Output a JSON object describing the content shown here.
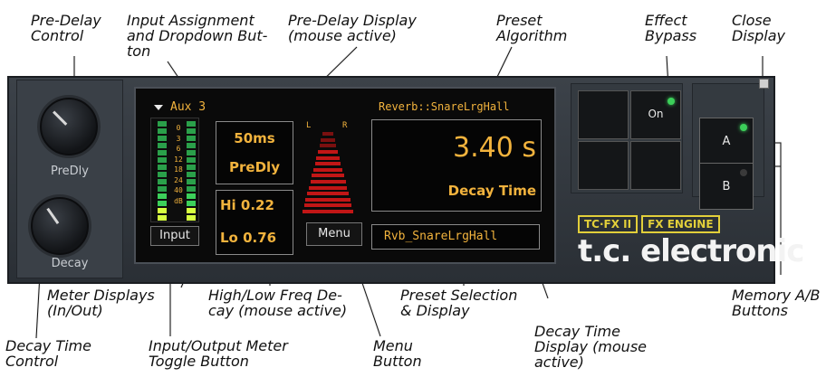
{
  "callouts": {
    "predelay_control": "Pre-Delay\nControl",
    "input_assignment": "Input Assignment\nand Dropdown But-\nton",
    "predelay_display": "Pre-Delay Display\n(mouse active)",
    "preset_algorithm": "Preset\nAlgorithm",
    "effect_bypass": "Effect\nBypass",
    "close_display": "Close\nDisplay",
    "meter_displays": "Meter Displays\n(In/Out)",
    "hilo_freq": "High/Low Freq De-\ncay (mouse active)",
    "preset_selection": "Preset Selection\n& Display",
    "memory_ab": "Memory A/B\nButtons",
    "decay_time_control": "Decay Time\nControl",
    "io_meter_toggle": "Input/Output Meter\nToggle Button",
    "menu_button": "Menu\nButton",
    "decay_time_display": "Decay Time\nDisplay (mouse\nactive)"
  },
  "plugin": {
    "knobs": {
      "predelay_label": "PreDly",
      "decay_label": "Decay"
    },
    "input_assignment": "Aux 3",
    "meter_scale": [
      "0",
      "3",
      "6",
      "12",
      "18",
      "24",
      "40",
      "dB"
    ],
    "input_toggle_label": "Input",
    "predelay": {
      "value": "50ms",
      "label": "PreDly"
    },
    "hi_freq": "Hi 0.22",
    "lo_freq": "Lo 0.76",
    "menu_label": "Menu",
    "meter_lr": {
      "left": "L",
      "right": "R"
    },
    "algorithm": "Reverb::SnareLrgHall",
    "decay": {
      "value": "3.40 s",
      "label": "Decay Time"
    },
    "preset_name": "Rvb_SnareLrgHall",
    "bypass_label": "On",
    "memory_a": "A",
    "memory_b": "B",
    "brand_tag_1": "TC·FX II",
    "brand_tag_2": "FX ENGINE",
    "brand_name": "t.c. electronic"
  },
  "colors": {
    "lcd_text": "#f2b33d",
    "led_green": "#3cd05a",
    "meter_red": "#c11616",
    "brand_yellow": "#e2cf3a"
  }
}
